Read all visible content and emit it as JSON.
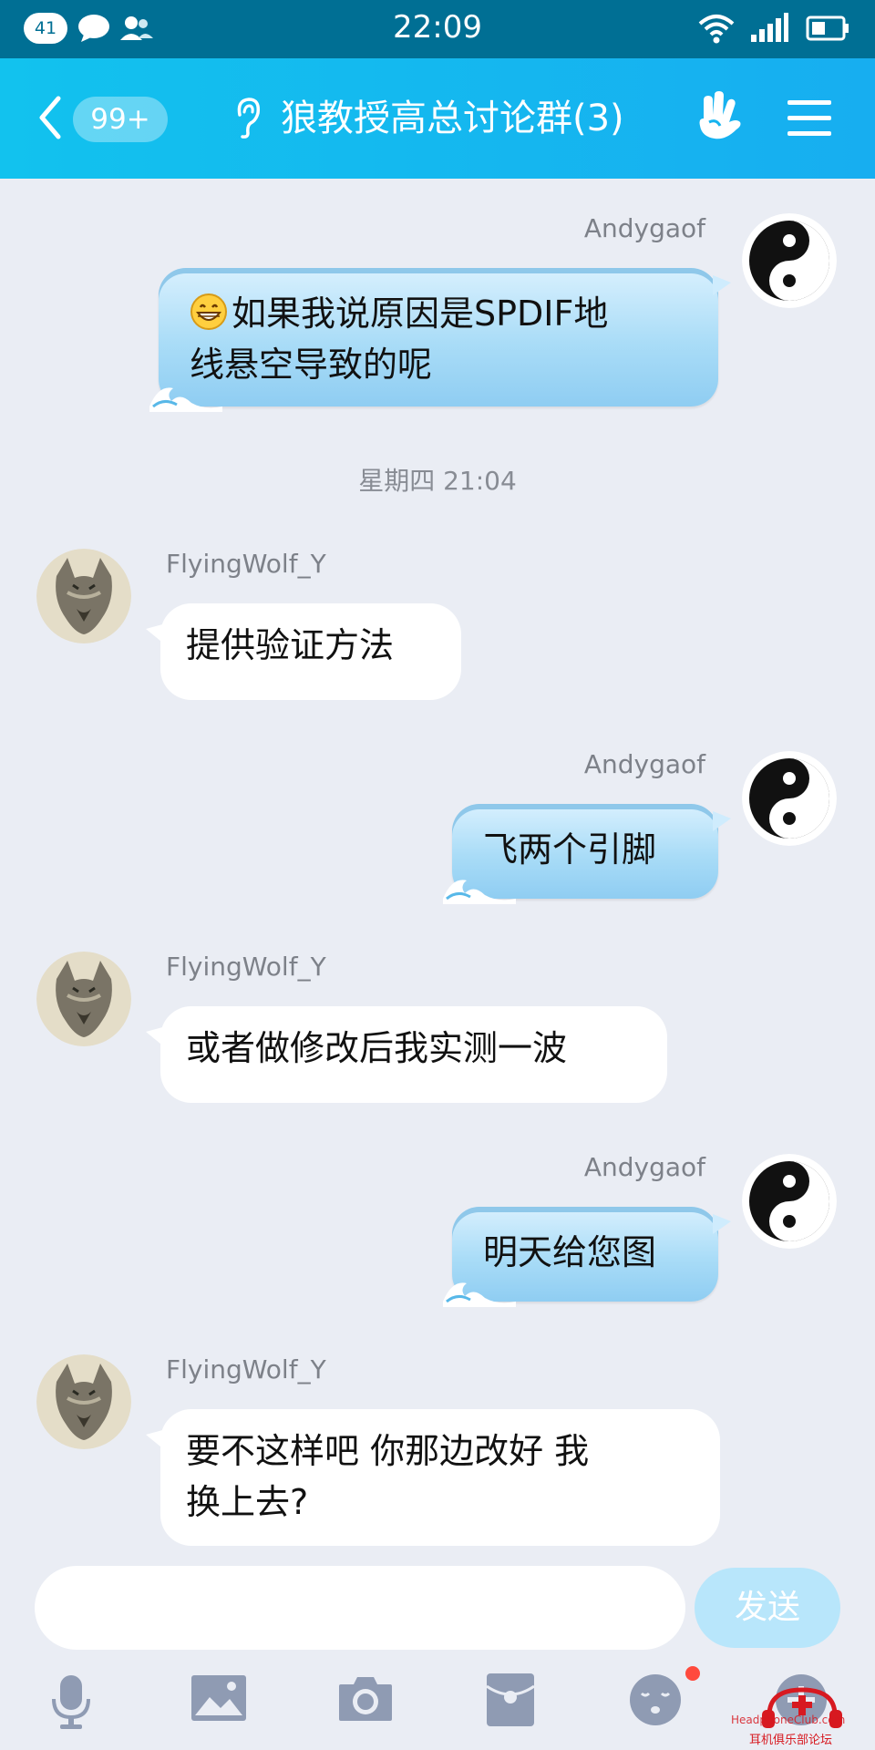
{
  "status_bar": {
    "notification_count": "41",
    "time": "22:09"
  },
  "header": {
    "unread_badge": "99+",
    "group_title": "狼教授高总讨论群(3)"
  },
  "messages": [
    {
      "sender": "Andygaof",
      "direction": "out",
      "text_line1": "如果我说原因是SPDIF地",
      "text_line2": "线悬空导致的呢",
      "has_emoji": "grinning-face"
    },
    {
      "timestamp": "星期四 21:04"
    },
    {
      "sender": "FlyingWolf_Y",
      "direction": "in",
      "text": "提供验证方法"
    },
    {
      "sender": "Andygaof",
      "direction": "out",
      "text": "飞两个引脚"
    },
    {
      "sender": "FlyingWolf_Y",
      "direction": "in",
      "text": "或者做修改后我实测一波"
    },
    {
      "sender": "Andygaof",
      "direction": "out",
      "text": "明天给您图"
    },
    {
      "sender": "FlyingWolf_Y",
      "direction": "in",
      "text_line1": "要不这样吧 你那边改好 我",
      "text_line2": "换上去?"
    }
  ],
  "composer": {
    "input_value": "",
    "send_label": "发送"
  },
  "toolbar": {
    "items": [
      "microphone-icon",
      "image-icon",
      "camera-icon",
      "red-packet-icon",
      "emoji-icon",
      "plus-icon"
    ]
  },
  "watermark": {
    "url": "HeadphoneClub.com",
    "text": "耳机俱乐部论坛"
  },
  "colors": {
    "header": "#14b8ef",
    "status_bar": "#006f94",
    "background": "#eaedf4",
    "outgoing_bubble": "#a9dcf7",
    "send_button": "#b8e6fb"
  }
}
